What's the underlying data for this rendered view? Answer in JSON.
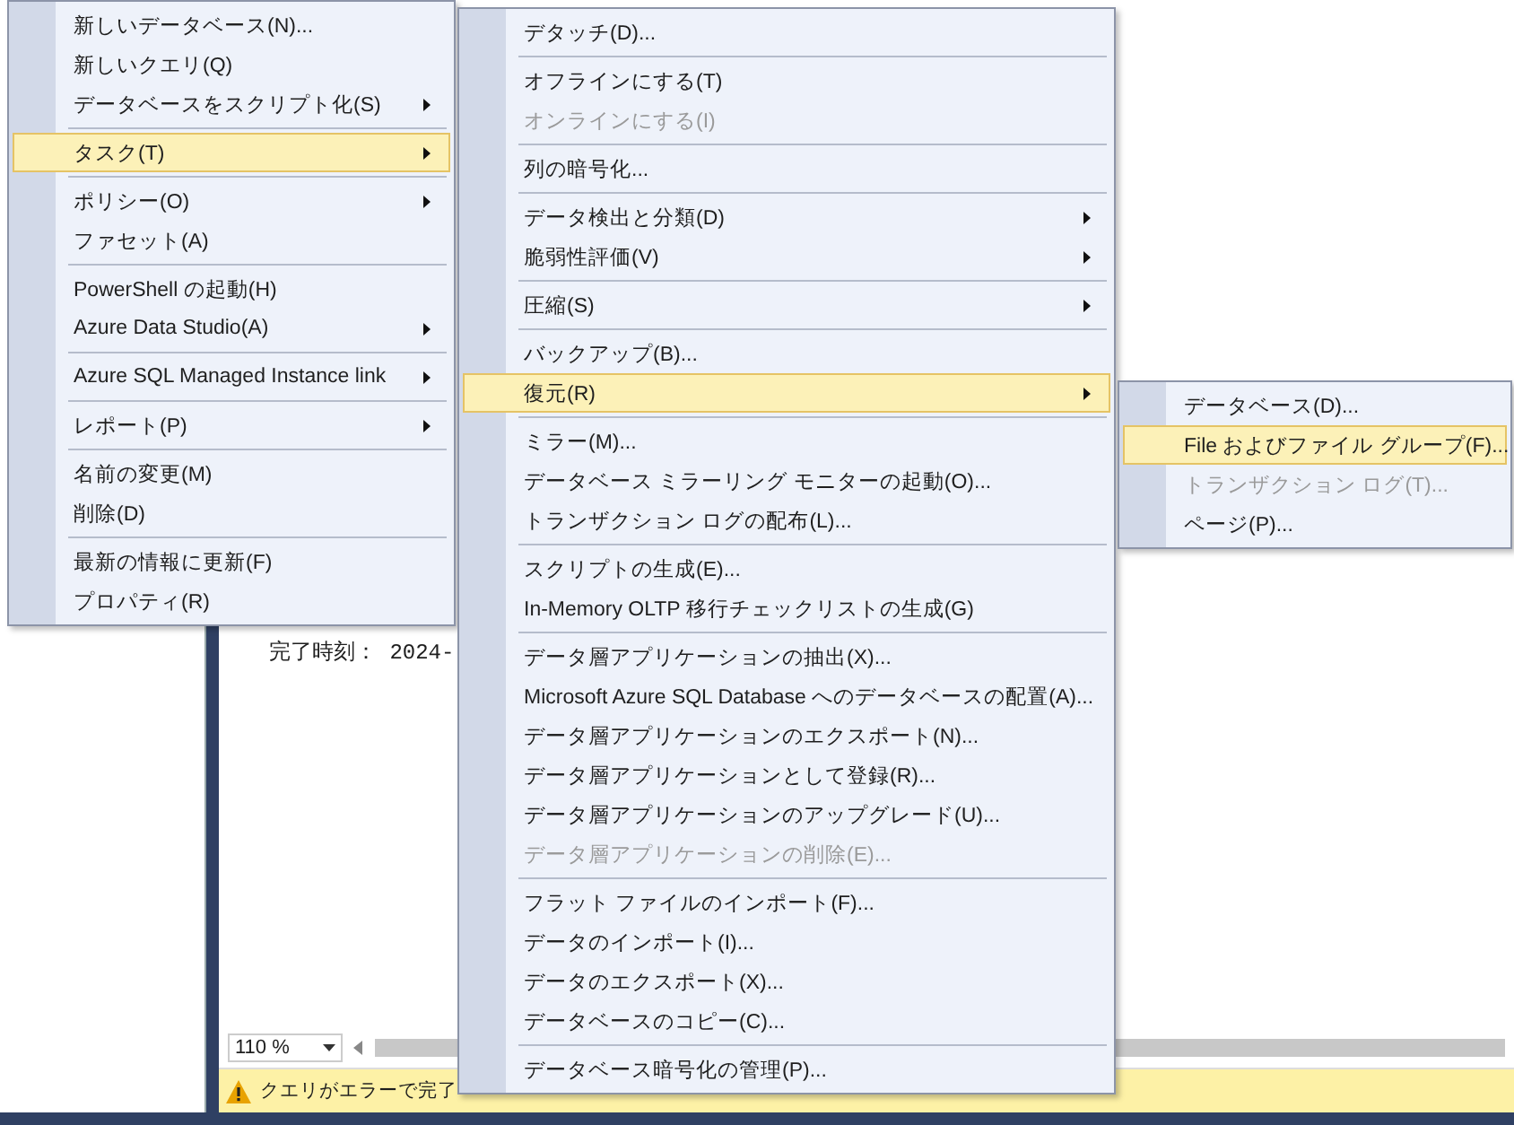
{
  "editor": {
    "message": "完了時刻： 2024-",
    "zoom": "110 %",
    "status": "クエリがエラーで完了"
  },
  "menus": [
    {
      "groups": [
        [
          {
            "label": "新しいデータベース(N)...",
            "has_submenu": false,
            "selected": false,
            "disabled": false
          },
          {
            "label": "新しいクエリ(Q)",
            "has_submenu": false,
            "selected": false,
            "disabled": false
          },
          {
            "label": "データベースをスクリプト化(S)",
            "has_submenu": true,
            "selected": false,
            "disabled": false
          }
        ],
        [
          {
            "label": "タスク(T)",
            "has_submenu": true,
            "selected": true,
            "disabled": false
          }
        ],
        [
          {
            "label": "ポリシー(O)",
            "has_submenu": true,
            "selected": false,
            "disabled": false
          },
          {
            "label": "ファセット(A)",
            "has_submenu": false,
            "selected": false,
            "disabled": false
          }
        ],
        [
          {
            "label": "PowerShell の起動(H)",
            "has_submenu": false,
            "selected": false,
            "disabled": false
          },
          {
            "label": "Azure Data Studio(A)",
            "has_submenu": true,
            "selected": false,
            "disabled": false
          }
        ],
        [
          {
            "label": "Azure SQL Managed Instance link",
            "has_submenu": true,
            "selected": false,
            "disabled": false
          }
        ],
        [
          {
            "label": "レポート(P)",
            "has_submenu": true,
            "selected": false,
            "disabled": false
          }
        ],
        [
          {
            "label": "名前の変更(M)",
            "has_submenu": false,
            "selected": false,
            "disabled": false
          },
          {
            "label": "削除(D)",
            "has_submenu": false,
            "selected": false,
            "disabled": false
          }
        ],
        [
          {
            "label": "最新の情報に更新(F)",
            "has_submenu": false,
            "selected": false,
            "disabled": false
          },
          {
            "label": "プロパティ(R)",
            "has_submenu": false,
            "selected": false,
            "disabled": false
          }
        ]
      ]
    },
    {
      "groups": [
        [
          {
            "label": "デタッチ(D)...",
            "has_submenu": false,
            "selected": false,
            "disabled": false
          }
        ],
        [
          {
            "label": "オフラインにする(T)",
            "has_submenu": false,
            "selected": false,
            "disabled": false
          },
          {
            "label": "オンラインにする(I)",
            "has_submenu": false,
            "selected": false,
            "disabled": true
          }
        ],
        [
          {
            "label": "列の暗号化...",
            "has_submenu": false,
            "selected": false,
            "disabled": false
          }
        ],
        [
          {
            "label": "データ検出と分類(D)",
            "has_submenu": true,
            "selected": false,
            "disabled": false
          },
          {
            "label": "脆弱性評価(V)",
            "has_submenu": true,
            "selected": false,
            "disabled": false
          }
        ],
        [
          {
            "label": "圧縮(S)",
            "has_submenu": true,
            "selected": false,
            "disabled": false
          }
        ],
        [
          {
            "label": "バックアップ(B)...",
            "has_submenu": false,
            "selected": false,
            "disabled": false
          },
          {
            "label": "復元(R)",
            "has_submenu": true,
            "selected": true,
            "disabled": false
          }
        ],
        [
          {
            "label": "ミラー(M)...",
            "has_submenu": false,
            "selected": false,
            "disabled": false
          },
          {
            "label": "データベース ミラーリング モニターの起動(O)...",
            "has_submenu": false,
            "selected": false,
            "disabled": false
          },
          {
            "label": "トランザクション ログの配布(L)...",
            "has_submenu": false,
            "selected": false,
            "disabled": false
          }
        ],
        [
          {
            "label": "スクリプトの生成(E)...",
            "has_submenu": false,
            "selected": false,
            "disabled": false
          },
          {
            "label": "In-Memory OLTP 移行チェックリストの生成(G)",
            "has_submenu": false,
            "selected": false,
            "disabled": false
          }
        ],
        [
          {
            "label": "データ層アプリケーションの抽出(X)...",
            "has_submenu": false,
            "selected": false,
            "disabled": false
          },
          {
            "label": "Microsoft Azure SQL Database へのデータベースの配置(A)...",
            "has_submenu": false,
            "selected": false,
            "disabled": false
          },
          {
            "label": "データ層アプリケーションのエクスポート(N)...",
            "has_submenu": false,
            "selected": false,
            "disabled": false
          },
          {
            "label": "データ層アプリケーションとして登録(R)...",
            "has_submenu": false,
            "selected": false,
            "disabled": false
          },
          {
            "label": "データ層アプリケーションのアップグレード(U)...",
            "has_submenu": false,
            "selected": false,
            "disabled": false
          },
          {
            "label": "データ層アプリケーションの削除(E)...",
            "has_submenu": false,
            "selected": false,
            "disabled": true
          }
        ],
        [
          {
            "label": "フラット ファイルのインポート(F)...",
            "has_submenu": false,
            "selected": false,
            "disabled": false
          },
          {
            "label": "データのインポート(I)...",
            "has_submenu": false,
            "selected": false,
            "disabled": false
          },
          {
            "label": "データのエクスポート(X)...",
            "has_submenu": false,
            "selected": false,
            "disabled": false
          },
          {
            "label": "データベースのコピー(C)...",
            "has_submenu": false,
            "selected": false,
            "disabled": false
          }
        ],
        [
          {
            "label": "データベース暗号化の管理(P)...",
            "has_submenu": false,
            "selected": false,
            "disabled": false
          }
        ]
      ]
    },
    {
      "groups": [
        [
          {
            "label": "データベース(D)...",
            "has_submenu": false,
            "selected": false,
            "disabled": false
          },
          {
            "label": "File およびファイル グループ(F)...",
            "has_submenu": false,
            "selected": true,
            "disabled": false
          },
          {
            "label": "トランザクション ログ(T)...",
            "has_submenu": false,
            "selected": false,
            "disabled": true
          },
          {
            "label": "ページ(P)...",
            "has_submenu": false,
            "selected": false,
            "disabled": false
          }
        ]
      ]
    }
  ]
}
